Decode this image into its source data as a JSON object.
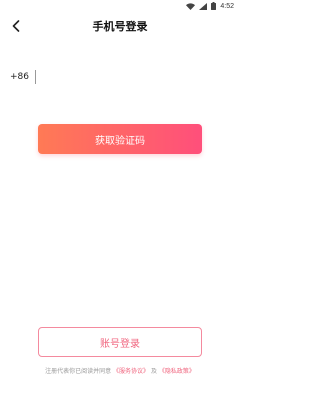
{
  "status_bar": {
    "time": "4:52",
    "icons": [
      "wifi-icon",
      "signal-icon",
      "battery-icon"
    ]
  },
  "header": {
    "title": "手机号登录",
    "back_icon": "chevron-left-icon"
  },
  "phone": {
    "country_code": "+86",
    "value": "",
    "placeholder": ""
  },
  "buttons": {
    "get_code": "获取验证码",
    "account_login": "账号登录"
  },
  "agreement": {
    "prefix": "注册代表你已阅读并同意",
    "service_link": "《服务协议》",
    "conjunction": "及",
    "privacy_link": "《隐私政策》"
  },
  "colors": {
    "accent_start": "#ff7a55",
    "accent_end": "#ff4f7b",
    "link": "#f0667f"
  }
}
